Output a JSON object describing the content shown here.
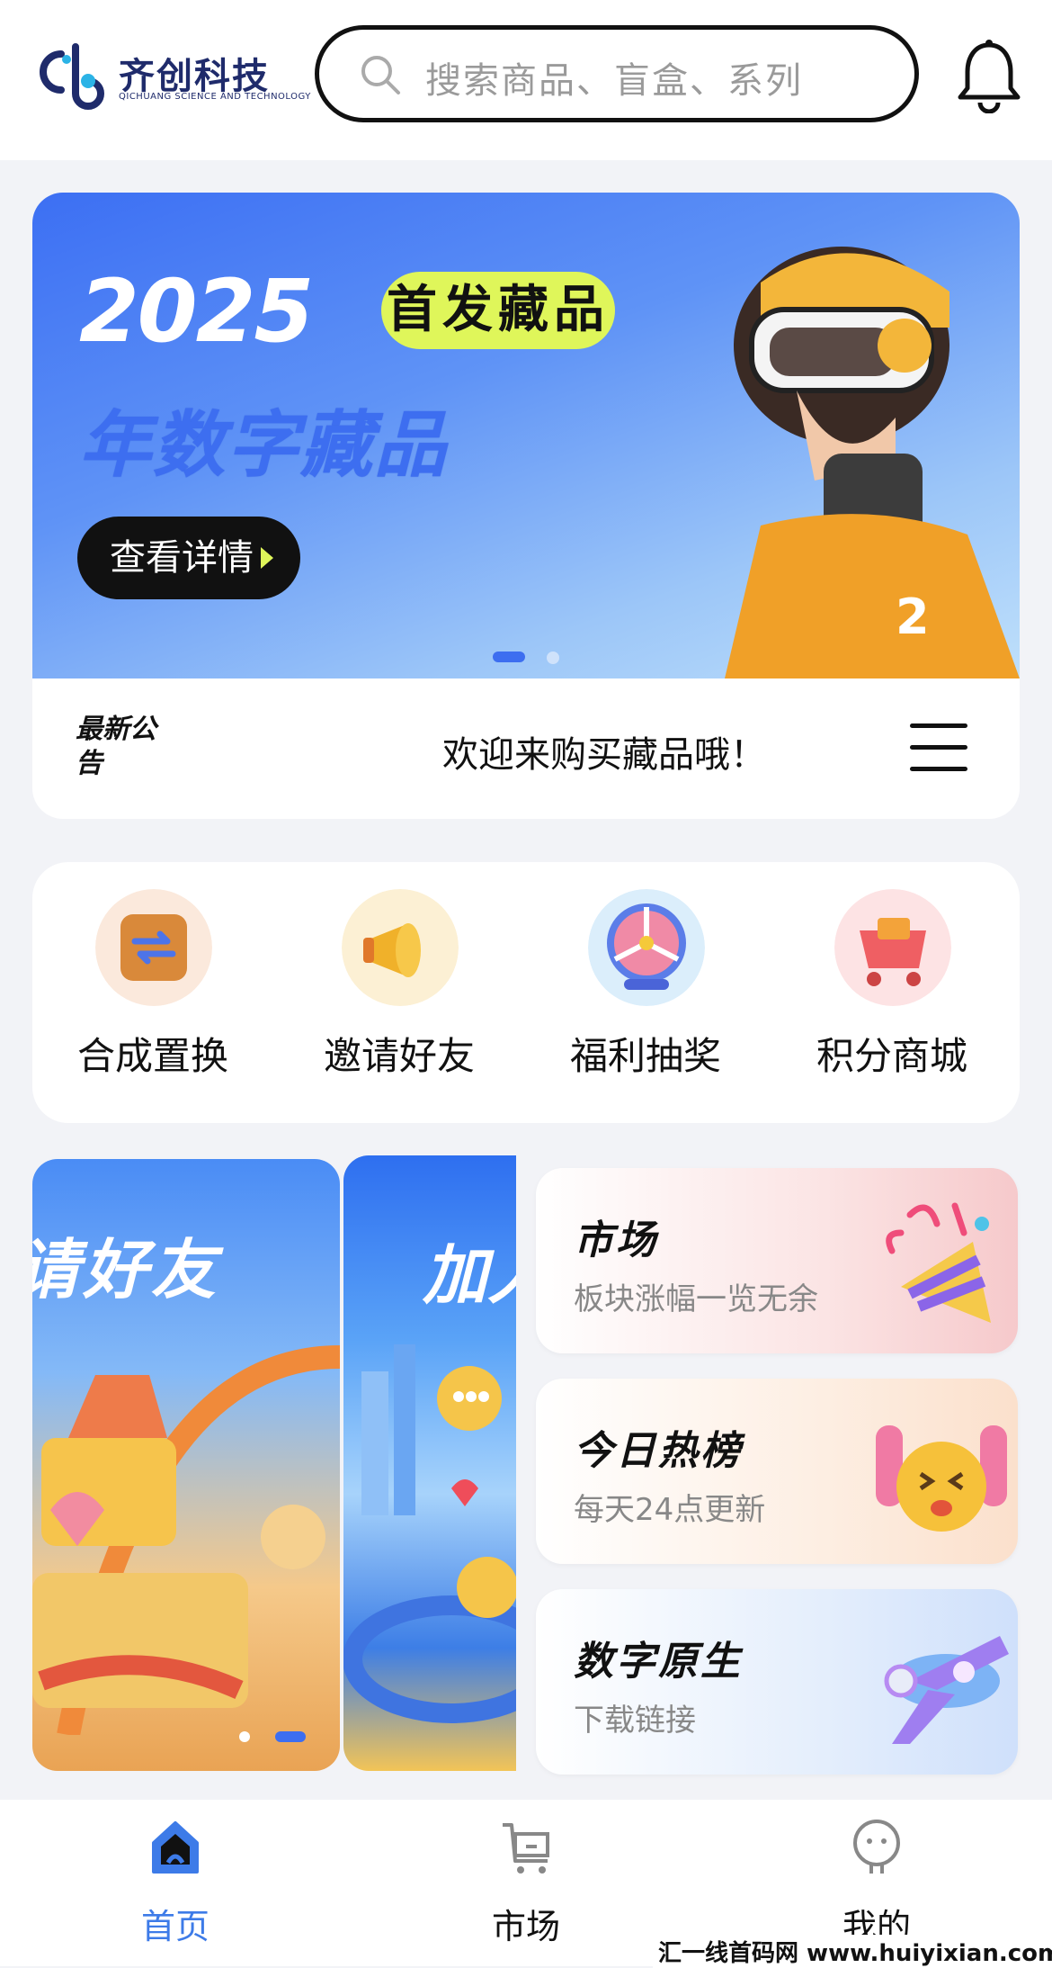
{
  "header": {
    "logo_text": "齐创科技",
    "logo_sub": "QICHUANG SCIENCE AND TECHNOLOGY",
    "search_placeholder": "搜索商品、盲盒、系列"
  },
  "banner": {
    "year": "2025",
    "tag": "首发藏品",
    "subtitle": "年数字藏品",
    "button": "查看详情"
  },
  "notice": {
    "label": "最新公告",
    "text": "欢迎来购买藏品哦！"
  },
  "quick_actions": [
    {
      "label": "合成置换",
      "icon": "swap-box-icon"
    },
    {
      "label": "邀请好友",
      "icon": "megaphone-icon"
    },
    {
      "label": "福利抽奖",
      "icon": "prize-wheel-icon"
    },
    {
      "label": "积分商城",
      "icon": "shopping-cart-icon"
    }
  ],
  "promos": {
    "promo1_title": "请好友",
    "promo2_title": "加入"
  },
  "feature_cards": [
    {
      "title": "市场",
      "subtitle": "板块涨幅一览无余",
      "icon": "party-popper-icon"
    },
    {
      "title": "今日热榜",
      "subtitle": "每天24点更新",
      "icon": "cheering-face-icon"
    },
    {
      "title": "数字原生",
      "subtitle": "下载链接",
      "icon": "airplane-icon"
    }
  ],
  "tabbar": [
    {
      "label": "首页",
      "active": true
    },
    {
      "label": "市场",
      "active": false
    },
    {
      "label": "我的",
      "active": false
    }
  ],
  "watermark": "汇一线首码网 www.huiyixian.com",
  "colors": {
    "accent": "#3d6ef0",
    "tag_green": "#dff65a",
    "tab_active": "#3d7be8"
  }
}
